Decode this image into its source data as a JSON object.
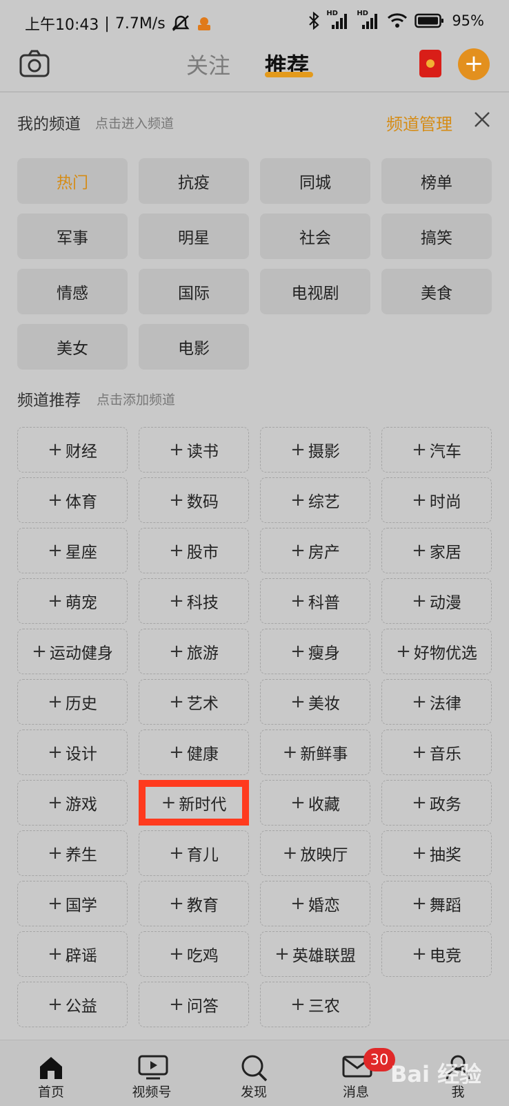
{
  "status_bar": {
    "time": "上午10:43",
    "separator": "|",
    "speed": "7.7M/s",
    "signal1_label": "HD",
    "signal2_label": "HD",
    "battery": "95%",
    "icons": [
      "mute-icon",
      "app-notification-icon",
      "bluetooth-icon",
      "signal-icon",
      "wifi-icon",
      "battery-icon"
    ]
  },
  "nav": {
    "tab_follow": "关注",
    "tab_recommend": "推荐",
    "plus_symbol": "+",
    "accent_color": "#e3901e",
    "icons": [
      "camera-icon",
      "red-packet-icon",
      "add-icon"
    ]
  },
  "my_channels": {
    "title": "我的频道",
    "hint": "点击进入频道",
    "manage_label": "频道管理",
    "items": [
      {
        "label": "热门",
        "active": true
      },
      {
        "label": "抗疫"
      },
      {
        "label": "同城"
      },
      {
        "label": "榜单"
      },
      {
        "label": "军事"
      },
      {
        "label": "明星"
      },
      {
        "label": "社会"
      },
      {
        "label": "搞笑"
      },
      {
        "label": "情感"
      },
      {
        "label": "国际"
      },
      {
        "label": "电视剧"
      },
      {
        "label": "美食"
      },
      {
        "label": "美女"
      },
      {
        "label": "电影"
      }
    ]
  },
  "recommended_channels": {
    "title": "频道推荐",
    "hint": "点击添加频道",
    "plus": "+",
    "highlight_color": "#ff3a1e",
    "items": [
      "财经",
      "读书",
      "摄影",
      "汽车",
      "体育",
      "数码",
      "综艺",
      "时尚",
      "星座",
      "股市",
      "房产",
      "家居",
      "萌宠",
      "科技",
      "科普",
      "动漫",
      "运动健身",
      "旅游",
      "瘦身",
      "好物优选",
      "历史",
      "艺术",
      "美妆",
      "法律",
      "设计",
      "健康",
      "新鲜事",
      "音乐",
      "游戏",
      "新时代",
      "收藏",
      "政务",
      "养生",
      "育儿",
      "放映厅",
      "抽奖",
      "国学",
      "教育",
      "婚恋",
      "舞蹈",
      "辟谣",
      "吃鸡",
      "英雄联盟",
      "电竞",
      "公益",
      "问答",
      "三农"
    ],
    "highlighted": "新时代"
  },
  "bottom_nav": {
    "items": [
      {
        "label": "首页",
        "icon": "home-icon"
      },
      {
        "label": "视频号",
        "icon": "video-icon"
      },
      {
        "label": "发现",
        "icon": "search-icon"
      },
      {
        "label": "消息",
        "icon": "mail-icon"
      },
      {
        "label": "我",
        "icon": "profile-icon"
      }
    ],
    "message_badge": "30"
  },
  "watermark": "Bai 经验"
}
